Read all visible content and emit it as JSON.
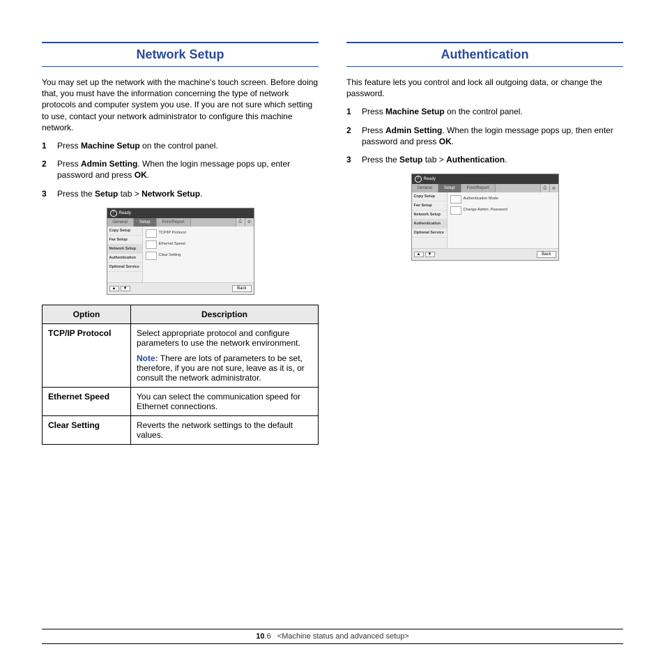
{
  "left": {
    "title": "Network Setup",
    "intro": "You may set up the network with the machine's touch screen. Before doing that, you must have the information concerning the type of network protocols and computer system you use. If you are not sure which setting to use, contact your network administrator to configure this machine network.",
    "steps": [
      {
        "num": "1",
        "pre": "Press ",
        "b1": "Machine Setup",
        "post": " on the control panel."
      },
      {
        "num": "2",
        "pre": "Press ",
        "b1": "Admin Setting",
        "mid": ". When the login message pops up, enter password and press ",
        "b2": "OK",
        "post": "."
      },
      {
        "num": "3",
        "pre": "Press the ",
        "b1": "Setup",
        "mid": " tab > ",
        "b2": "Network Setup",
        "post": "."
      }
    ],
    "mock": {
      "ready": "Ready",
      "tabs": [
        "General",
        "Setup",
        "Print/Report"
      ],
      "side": [
        "Copy Setup",
        "Fax Setup",
        "Network Setup",
        "Authentication",
        "Optional Service"
      ],
      "opts": [
        "TCP/IP Protocol",
        "Ethernet Speed",
        "Clear Setting"
      ],
      "back": "Back"
    },
    "table": {
      "head": [
        "Option",
        "Description"
      ],
      "rows": [
        {
          "name": "TCP/IP Protocol",
          "desc": "Select appropriate protocol and configure parameters to use the network environment.",
          "noteLabel": "Note:",
          "note": " There are lots of parameters to be set, therefore, if you are not sure, leave as it is, or consult the network administrator."
        },
        {
          "name": "Ethernet Speed",
          "desc": "You can select the communication speed for Ethernet connections."
        },
        {
          "name": "Clear Setting",
          "desc": "Reverts the network settings to the default values."
        }
      ]
    }
  },
  "right": {
    "title": "Authentication",
    "intro": "This feature lets you control and lock all outgoing data, or change the password.",
    "steps": [
      {
        "num": "1",
        "pre": "Press ",
        "b1": "Machine Setup",
        "post": " on the control panel."
      },
      {
        "num": "2",
        "pre": "Press ",
        "b1": "Admin Setting",
        "mid": ". When the login message pops up, then enter password and press ",
        "b2": "OK",
        "post": "."
      },
      {
        "num": "3",
        "pre": "Press the ",
        "b1": "Setup",
        "mid": " tab > ",
        "b2": "Authentication",
        "post": "."
      }
    ],
    "mock": {
      "ready": "Ready",
      "tabs": [
        "General",
        "Setup",
        "Print/Report"
      ],
      "side": [
        "Copy Setup",
        "Fax Setup",
        "Network Setup",
        "Authentication",
        "Optional Service"
      ],
      "opts": [
        "Authentication Mode",
        "Change Admin. Password"
      ],
      "back": "Back"
    }
  },
  "footer": {
    "chapter": "10",
    "page": ".6",
    "label": "<Machine status and advanced setup>"
  }
}
